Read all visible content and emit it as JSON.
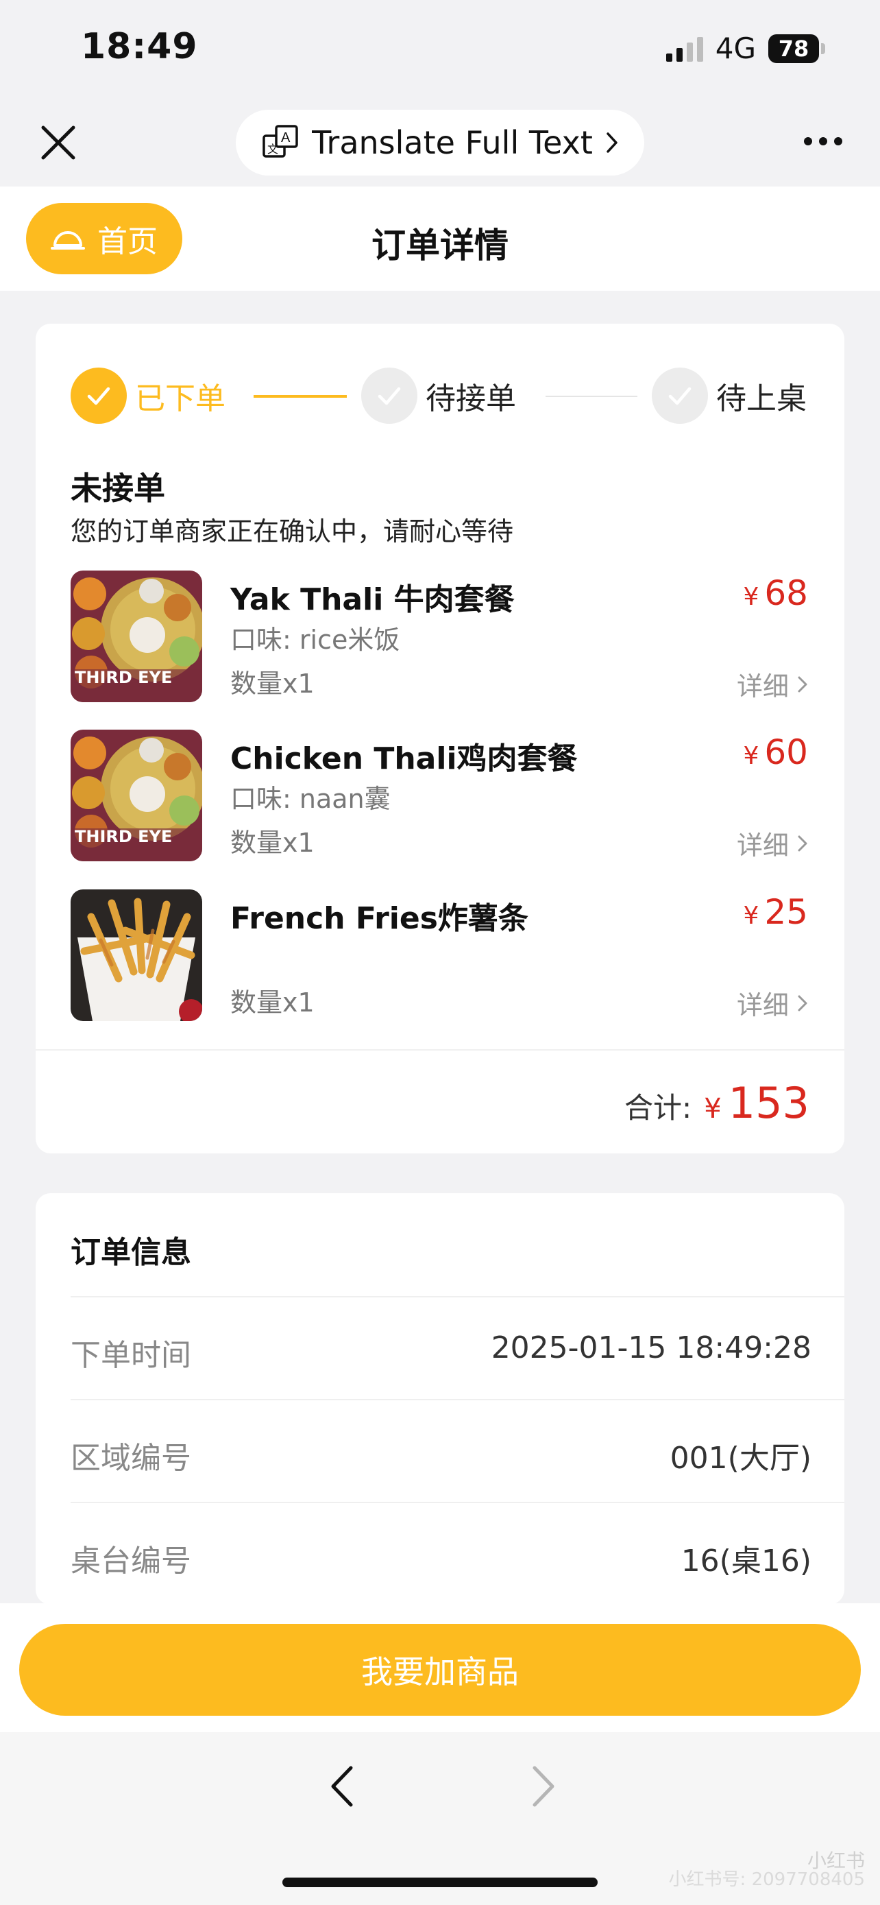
{
  "status_bar": {
    "time": "18:49",
    "network": "4G",
    "battery": "78"
  },
  "topbar": {
    "translate_label": "Translate Full Text"
  },
  "header": {
    "home_label": "首页",
    "title": "订单详情"
  },
  "progress": {
    "steps": [
      {
        "label": "已下单",
        "active": true
      },
      {
        "label": "待接单",
        "active": false
      },
      {
        "label": "待上桌",
        "active": false
      }
    ]
  },
  "order_status": {
    "title": "未接单",
    "description": "您的订单商家正在确认中，请耐心等待"
  },
  "items": [
    {
      "name": "Yak Thali 牛肉套餐",
      "option": "口味: rice米饭",
      "quantity": "数量x1",
      "currency": "¥",
      "price": "68",
      "detail_label": "详细",
      "image_text": "THIRD EYE"
    },
    {
      "name": "Chicken Thali鸡肉套餐",
      "option": "口味: naan囊",
      "quantity": "数量x1",
      "currency": "¥",
      "price": "60",
      "detail_label": "详细",
      "image_text": "THIRD EYE"
    },
    {
      "name": "French Fries炸薯条",
      "option": "",
      "quantity": "数量x1",
      "currency": "¥",
      "price": "25",
      "detail_label": "详细"
    }
  ],
  "total": {
    "label": "合计:",
    "currency": "¥",
    "value": "153"
  },
  "order_info": {
    "title": "订单信息",
    "rows": [
      {
        "label": "下单时间",
        "value": "2025-01-15 18:49:28"
      },
      {
        "label": "区域编号",
        "value": "001(大厅)"
      },
      {
        "label": "桌台编号",
        "value": "16(桌16)"
      }
    ]
  },
  "footer": {
    "add_button_label": "我要加商品"
  },
  "watermark": {
    "brand": "小红书",
    "id": "小红书号: 2097708405"
  },
  "colors": {
    "accent": "#fdbb1f",
    "price": "#d9281e"
  }
}
